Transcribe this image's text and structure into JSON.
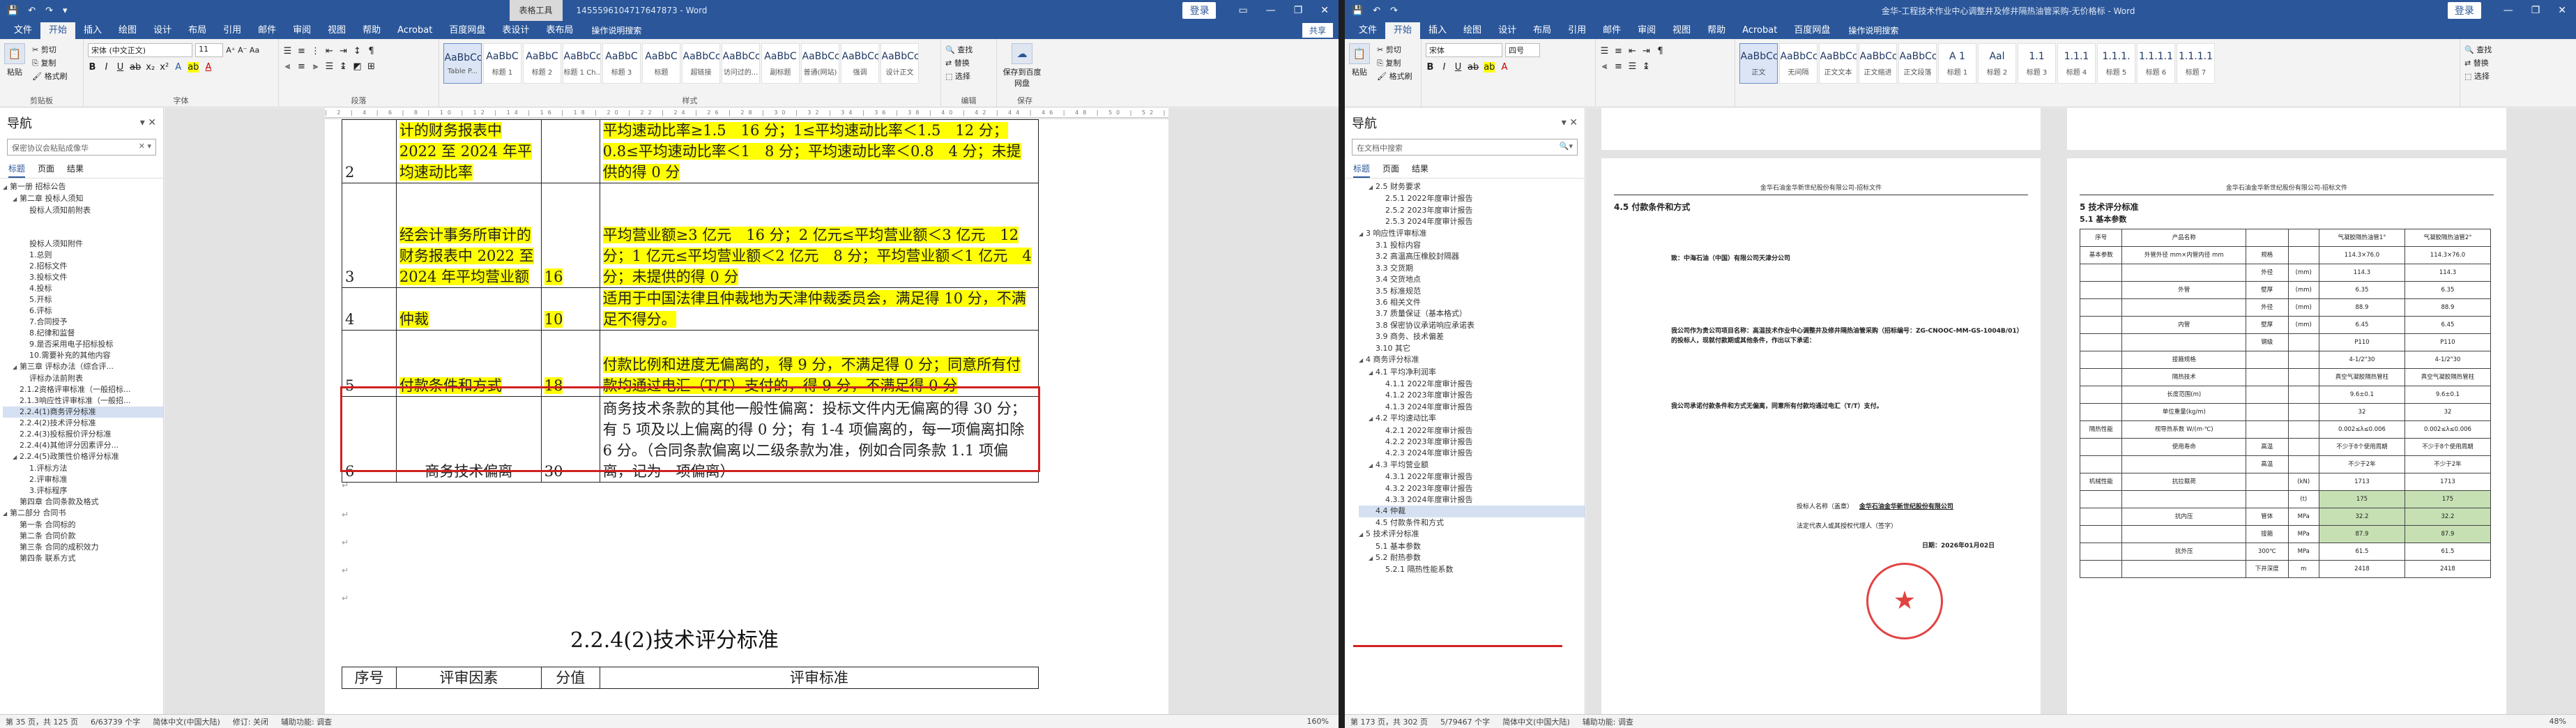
{
  "w1": {
    "title_ctx": "表格工具",
    "doc_title": "1455596104717647873 - Word",
    "signin": "登录",
    "qat": [
      "💾",
      "↶",
      "↷",
      "▾"
    ],
    "ctrl": [
      "▭",
      "—",
      "❐",
      "✕"
    ],
    "menu": [
      "文件",
      "开始",
      "插入",
      "绘图",
      "设计",
      "布局",
      "引用",
      "邮件",
      "审阅",
      "视图",
      "帮助",
      "Acrobat",
      "百度网盘",
      "表设计",
      "表布局"
    ],
    "active_menu": "开始",
    "tell": "操作说明搜索",
    "share": "共享",
    "clip": {
      "paste": "粘贴",
      "cut": "剪切",
      "copy": "复制",
      "painter": "格式刷",
      "label": "剪贴板"
    },
    "font": {
      "name": "宋体 (中文正文)",
      "size": "11",
      "label": "字体"
    },
    "para_label": "段落",
    "styles": [
      {
        "p": "AaBbCcI",
        "n": "Table P..."
      },
      {
        "p": "AaBbC",
        "n": "标题 1"
      },
      {
        "p": "AaBbC",
        "n": "标题 2"
      },
      {
        "p": "AaBbCcI",
        "n": "标题 1 Ch..."
      },
      {
        "p": "AaBbC",
        "n": "标题 3"
      },
      {
        "p": "AaBbC",
        "n": "标题"
      },
      {
        "p": "AaBbCcI",
        "n": "超链接"
      },
      {
        "p": "AaBbCcI",
        "n": "访问过的..."
      },
      {
        "p": "AaBbC",
        "n": "副标题"
      },
      {
        "p": "AaBbCcD",
        "n": "普通(网站)"
      },
      {
        "p": "AaBbCcD",
        "n": "强调"
      },
      {
        "p": "AaBbCcD",
        "n": "设计正文"
      }
    ],
    "styles_label": "样式",
    "edit": {
      "find": "查找",
      "replace": "替换",
      "select": "选择",
      "label": "编辑"
    },
    "baidu": {
      "save": "保存到百度网盘",
      "label": "保存"
    },
    "nav": {
      "title": "导航",
      "search": "保密协议会粘贴成像华",
      "tabs": [
        "标题",
        "页面",
        "结果"
      ],
      "items": [
        {
          "t": "第一册 招标公告",
          "l": 0,
          "a": "◢"
        },
        {
          "t": "第二章 投标人须知",
          "l": 1,
          "a": "◢"
        },
        {
          "t": "投标人须知前附表",
          "l": 2,
          "a": ""
        },
        {
          "t": "",
          "l": 2,
          "a": ""
        },
        {
          "t": "",
          "l": 2,
          "a": ""
        },
        {
          "t": "投标人须知附件",
          "l": 2,
          "a": ""
        },
        {
          "t": "1.总则",
          "l": 2,
          "a": ""
        },
        {
          "t": "2.招标文件",
          "l": 2,
          "a": ""
        },
        {
          "t": "3.投标文件",
          "l": 2,
          "a": ""
        },
        {
          "t": "4.投标",
          "l": 2,
          "a": ""
        },
        {
          "t": "5.开标",
          "l": 2,
          "a": ""
        },
        {
          "t": "6.评标",
          "l": 2,
          "a": ""
        },
        {
          "t": "7.合同授予",
          "l": 2,
          "a": ""
        },
        {
          "t": "8.纪律和监督",
          "l": 2,
          "a": ""
        },
        {
          "t": "9.是否采用电子招标投标",
          "l": 2,
          "a": ""
        },
        {
          "t": "10.需要补充的其他内容",
          "l": 2,
          "a": ""
        },
        {
          "t": "第三章 评标办法（综合评...",
          "l": 1,
          "a": "◢"
        },
        {
          "t": "评标办法前附表",
          "l": 2,
          "a": ""
        },
        {
          "t": "2.1.2资格评审标准（一般招标...",
          "l": 1,
          "a": ""
        },
        {
          "t": "2.1.3响应性评审标准（一般招...",
          "l": 1,
          "a": ""
        },
        {
          "t": "2.2.4(1)商务评分标准",
          "l": 1,
          "a": "",
          "hl": true
        },
        {
          "t": "2.2.4(2)技术评分标准",
          "l": 1,
          "a": ""
        },
        {
          "t": "2.2.4(3)投标报价评分标准",
          "l": 1,
          "a": ""
        },
        {
          "t": "2.2.4(4)其他评分因素评分...",
          "l": 1,
          "a": ""
        },
        {
          "t": "2.2.4(5)政策性价格评分标准",
          "l": 1,
          "a": "◢"
        },
        {
          "t": "1.评标方法",
          "l": 2,
          "a": ""
        },
        {
          "t": "2.评审标准",
          "l": 2,
          "a": ""
        },
        {
          "t": "3.评标程序",
          "l": 2,
          "a": ""
        },
        {
          "t": "第四章 合同条款及格式",
          "l": 1,
          "a": ""
        },
        {
          "t": "第二部分 合同书",
          "l": 0,
          "a": "◢"
        },
        {
          "t": "第一条 合同标的",
          "l": 1,
          "a": ""
        },
        {
          "t": "第二条 合同价款",
          "l": 1,
          "a": ""
        },
        {
          "t": "第三条 合同的成积效力",
          "l": 1,
          "a": ""
        },
        {
          "t": "第四条 联系方式",
          "l": 1,
          "a": ""
        }
      ]
    },
    "table_rows": [
      {
        "no": "2",
        "factor": "计的财务报表中 2022 至 2024 年平均速动比率",
        "score": "",
        "standard": "平均速动比率≥1.5　16 分；1≤平均速动比率＜1.5　12 分；0.8≤平均速动比率＜1　8 分；平均速动比率＜0.8　4 分；未提供的得 0 分"
      },
      {
        "no": "3",
        "factor": "经会计事务所审计的财务报表中 2022 至 2024 年平均营业额",
        "score": "16",
        "standard": "平均营业额≥3 亿元　16 分；2 亿元≤平均营业额＜3 亿元　12 分；1 亿元≤平均营业额＜2 亿元　8 分；平均营业额＜1 亿元　4 分；未提供的得 0 分"
      },
      {
        "no": "4",
        "factor": "仲裁",
        "score": "10",
        "standard": "适用于中国法律且仲裁地为天津仲裁委员会，满足得 10 分，不满足不得分。"
      },
      {
        "no": "5",
        "factor": "付款条件和方式",
        "score": "18",
        "standard": "付款比例和进度无偏离的，得 9 分，不满足得 0 分；同意所有付款均通过电汇（T/T）支付的，得 9 分，不满足得 0 分"
      },
      {
        "no": "6",
        "factor": "商务技术偏离",
        "score": "30",
        "standard": "商务技术条款的其他一般性偏离：投标文件内无偏离的得 30 分；有 5 项及以上偏离的得 0 分；有 1-4 项偏离的，每一项偏离扣除 6 分。（合同条款偏离以二级条款为准，例如合同条款 1.1 项偏离，记为一项偏离）"
      }
    ],
    "heading": "2.2.4(2)技术评分标准",
    "table2_header": [
      "序号",
      "评审因素",
      "分值",
      "评审标准"
    ],
    "status": [
      "第 35 页，共 125 页",
      "6/63739 个字",
      "简体中文(中国大陆)",
      "修订: 关闭",
      "辅助功能: 调查"
    ],
    "zoom": "160%"
  },
  "w2": {
    "doc_title": "金华-工程技术作业中心调整井及修井隔热油管采购-无价格标 - Word",
    "signin": "登录",
    "menu": [
      "文件",
      "开始",
      "插入",
      "绘图",
      "设计",
      "布局",
      "引用",
      "邮件",
      "审阅",
      "视图",
      "帮助",
      "Acrobat",
      "百度网盘"
    ],
    "active_menu": "开始",
    "tell": "操作说明搜索",
    "font": {
      "name": "宋体",
      "size": "四号"
    },
    "styles": [
      {
        "p": "AaBbCcDd",
        "n": "正文"
      },
      {
        "p": "AaBbCcDd",
        "n": "无间隔"
      },
      {
        "p": "AaBbCcDd",
        "n": "正文文本"
      },
      {
        "p": "AaBbCc",
        "n": "正文缩进"
      },
      {
        "p": "AaBbCcDd",
        "n": "正文段落"
      },
      {
        "p": "A 1",
        "n": "标题 1"
      },
      {
        "p": "Aal",
        "n": "标题 2"
      },
      {
        "p": "1.1",
        "n": "标题 3"
      },
      {
        "p": "1.1.1",
        "n": "标题 4"
      },
      {
        "p": "1.1.1.",
        "n": "标题 5"
      },
      {
        "p": "1.1.1.1",
        "n": "标题 6"
      },
      {
        "p": "1.1.1.1",
        "n": "标题 7"
      }
    ],
    "nav": {
      "title": "导航",
      "search": "在文档中搜索",
      "tabs": [
        "标题",
        "页面",
        "结果"
      ],
      "items": [
        {
          "t": "2.5 财务要求",
          "l": 1,
          "a": "◢"
        },
        {
          "t": "2.5.1 2022年度审计报告",
          "l": 2,
          "a": ""
        },
        {
          "t": "2.5.2 2023年度审计报告",
          "l": 2,
          "a": ""
        },
        {
          "t": "2.5.3 2024年度审计报告",
          "l": 2,
          "a": ""
        },
        {
          "t": "3 响应性评审标准",
          "l": 0,
          "a": "◢"
        },
        {
          "t": "3.1 投标内容",
          "l": 1,
          "a": ""
        },
        {
          "t": "3.2 高温高压橡胶封隔器",
          "l": 1,
          "a": ""
        },
        {
          "t": "3.3 交货期",
          "l": 1,
          "a": ""
        },
        {
          "t": "3.4 交货地点",
          "l": 1,
          "a": ""
        },
        {
          "t": "3.5 标准规范",
          "l": 1,
          "a": ""
        },
        {
          "t": "3.6 相关文件",
          "l": 1,
          "a": ""
        },
        {
          "t": "3.7 质量保证（基本格式）",
          "l": 1,
          "a": ""
        },
        {
          "t": "3.8 保密协议承诺响应承诺表",
          "l": 1,
          "a": ""
        },
        {
          "t": "3.9 商务、技术偏差",
          "l": 1,
          "a": ""
        },
        {
          "t": "3.10 其它",
          "l": 1,
          "a": ""
        },
        {
          "t": "4 商务评分标准",
          "l": 0,
          "a": "◢"
        },
        {
          "t": "4.1 平均净利润率",
          "l": 1,
          "a": "◢"
        },
        {
          "t": "4.1.1 2022年度审计报告",
          "l": 2,
          "a": ""
        },
        {
          "t": "4.1.2 2023年度审计报告",
          "l": 2,
          "a": ""
        },
        {
          "t": "4.1.3 2024年度审计报告",
          "l": 2,
          "a": ""
        },
        {
          "t": "4.2 平均速动比率",
          "l": 1,
          "a": "◢"
        },
        {
          "t": "4.2.1 2022年度审计报告",
          "l": 2,
          "a": ""
        },
        {
          "t": "4.2.2 2023年度审计报告",
          "l": 2,
          "a": ""
        },
        {
          "t": "4.2.3 2024年度审计报告",
          "l": 2,
          "a": ""
        },
        {
          "t": "4.3 平均营业额",
          "l": 1,
          "a": "◢"
        },
        {
          "t": "4.3.1 2022年度审计报告",
          "l": 2,
          "a": ""
        },
        {
          "t": "4.3.2 2023年度审计报告",
          "l": 2,
          "a": ""
        },
        {
          "t": "4.3.3 2024年度审计报告",
          "l": 2,
          "a": ""
        },
        {
          "t": "4.4 仲裁",
          "l": 1,
          "a": "",
          "hl": true
        },
        {
          "t": "4.5 付款条件和方式",
          "l": 1,
          "a": ""
        },
        {
          "t": "5 技术评分标准",
          "l": 0,
          "a": "◢"
        },
        {
          "t": "5.1 基本参数",
          "l": 1,
          "a": ""
        },
        {
          "t": "5.2 耐热参数",
          "l": 1,
          "a": "◢"
        },
        {
          "t": "5.2.1 隔热性能系数",
          "l": 2,
          "a": ""
        }
      ]
    },
    "page_header": "金华石油金华新世纪股份有限公司-招标文件",
    "page_a": {
      "heading": "4.5 付款条件和方式",
      "to": "致：中海石油（中国）有限公司天津分公司",
      "body": "我公司作为贵公司项目名称：高温技术作业中心调整井及修井隔热油管采购（招标编号：ZG-CNOOC-MM-GS-1004B/01）的投标人，现就付款期或其他条件，作出以下承诺：",
      "promise": "我公司承诺付款条件和方式无偏离，同意所有付款均通过电汇（T/T）支付。",
      "sign_label": "投标人名称（盖章）",
      "sign_name": "金华石油金华新世纪股份有限公司",
      "rep": "法定代表人或其授权代理人（签字）",
      "date": "日期：2026年01月02日"
    },
    "page_b": {
      "heading": "5 技术评分标准",
      "sub": "5.1 基本参数",
      "head": [
        "序号",
        "产品名称",
        "",
        "",
        "气凝胶隔热油管1°",
        "气凝胶隔热油管2°"
      ],
      "rows": [
        [
          "基本参数",
          "外管外径 mm×内管内径 mm",
          "规格",
          "",
          "114.3×76.0",
          "114.3×76.0"
        ],
        [
          "",
          "",
          "外径",
          "(mm)",
          "114.3",
          "114.3"
        ],
        [
          "",
          "外管",
          "壁厚",
          "(mm)",
          "6.35",
          "6.35"
        ],
        [
          "",
          "",
          "外径",
          "(mm)",
          "88.9",
          "88.9"
        ],
        [
          "",
          "内管",
          "壁厚",
          "(mm)",
          "6.45",
          "6.45"
        ],
        [
          "",
          "",
          "钢级",
          "",
          "P110",
          "P110"
        ],
        [
          "",
          "接箍规格",
          "",
          "",
          "4-1/2\"30",
          "4-1/2\"30"
        ],
        [
          "",
          "隔热技术",
          "",
          "",
          "真空气凝胶隔热管柱",
          "真空气凝胶隔热管柱"
        ],
        [
          "",
          "长度范围(m)",
          "",
          "",
          "9.6±0.1",
          "9.6±0.1"
        ],
        [
          "",
          "单位重量(kg/m)",
          "",
          "",
          "32",
          "32"
        ],
        [
          "隔热性能",
          "视导热系数 W/(m·℃)",
          "",
          "",
          "0.002≤λ≤0.006",
          "0.002≤λ≤0.006"
        ],
        [
          "",
          "使用寿命",
          "高温",
          "",
          "不少于8个使用周期",
          "不少于8个使用周期"
        ],
        [
          "",
          "",
          "高温",
          "",
          "不少于2年",
          "不少于2年"
        ],
        [
          "机械性能",
          "抗拉载荷",
          "",
          "(kN)",
          "1713",
          "1713"
        ],
        [
          "",
          "",
          "",
          "(t)",
          "175",
          "175"
        ],
        [
          "",
          "抗内压",
          "管体",
          "MPa",
          "32.2",
          "32.2"
        ],
        [
          "",
          "",
          "接箍",
          "MPa",
          "87.9",
          "87.9"
        ],
        [
          "",
          "抗外压",
          "300℃",
          "MPa",
          "61.5",
          "61.5"
        ],
        [
          "",
          "",
          "下井深度",
          "m",
          "2418",
          "2418"
        ]
      ]
    },
    "status": [
      "第 173 页，共 302 页",
      "5/79467 个字",
      "简体中文(中国大陆)",
      "辅助功能: 调查"
    ],
    "zoom": "48%"
  }
}
